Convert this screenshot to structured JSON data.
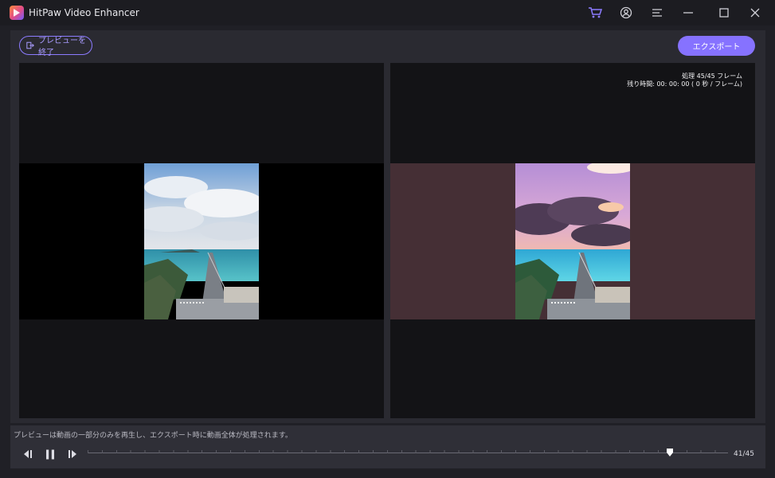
{
  "window": {
    "title": "HitPaw Video Enhancer"
  },
  "titlebar_icons": [
    "cart-icon",
    "account-icon",
    "menu-icon",
    "minimize-icon",
    "maximize-icon",
    "close-icon"
  ],
  "toolbar": {
    "exit_preview_label": "プレビューを終了",
    "export_label": "エクスポート"
  },
  "preview": {
    "processed_text": "処理 45/45 フレーム",
    "remaining_text": "残り時間: 00: 00: 00 ( 0 秒 / フレーム)"
  },
  "footer": {
    "hint": "プレビューは動画の一部分のみを再生し、エクスポート時に動画全体が処理されます。",
    "frame_counter": "41/45",
    "current_frame": 41,
    "total_frames": 45
  },
  "colors": {
    "accent": "#8672ff",
    "accent_outline": "#8c7bff",
    "enhanced_backdrop": "#452f35"
  }
}
